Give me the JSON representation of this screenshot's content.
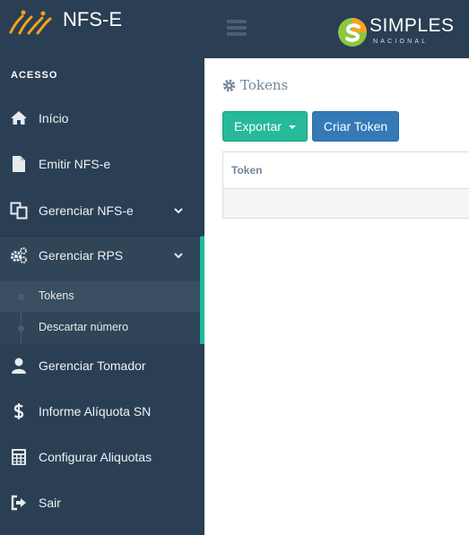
{
  "app": {
    "name": "NFS-E"
  },
  "header": {
    "brand_word": "SIMPLES",
    "brand_sub": "NACIONAL"
  },
  "sidebar": {
    "section_title": "ACESSO",
    "items": [
      {
        "label": "Início",
        "icon": "home-icon"
      },
      {
        "label": "Emitir NFS-e",
        "icon": "file-icon"
      },
      {
        "label": "Gerenciar NFS-e",
        "icon": "copy-icon",
        "chevron": "chevron-down-icon"
      },
      {
        "label": "Gerenciar RPS",
        "icon": "gears-icon",
        "chevron": "chevron-down-icon",
        "expanded": true
      },
      {
        "label": "Gerenciar Tomador",
        "icon": "user-icon"
      },
      {
        "label": "Informe Alíquota SN",
        "icon": "dollar-icon"
      },
      {
        "label": "Configurar Aliquotas",
        "icon": "calculator-icon"
      },
      {
        "label": "Sair",
        "icon": "sign-out-icon"
      }
    ],
    "rps_subitems": [
      {
        "label": "Tokens",
        "active": true
      },
      {
        "label": "Descartar número",
        "active": false
      }
    ]
  },
  "main": {
    "title": "Tokens",
    "title_icon": "gear-icon",
    "export_label": "Exportar",
    "create_label": "Criar Token",
    "table": {
      "columns": [
        "Token"
      ],
      "rows": []
    }
  },
  "colors": {
    "sidebar": "#2a3f54",
    "accent": "#1abb9c",
    "export_btn": "#26b99a",
    "create_btn": "#337ab7"
  }
}
